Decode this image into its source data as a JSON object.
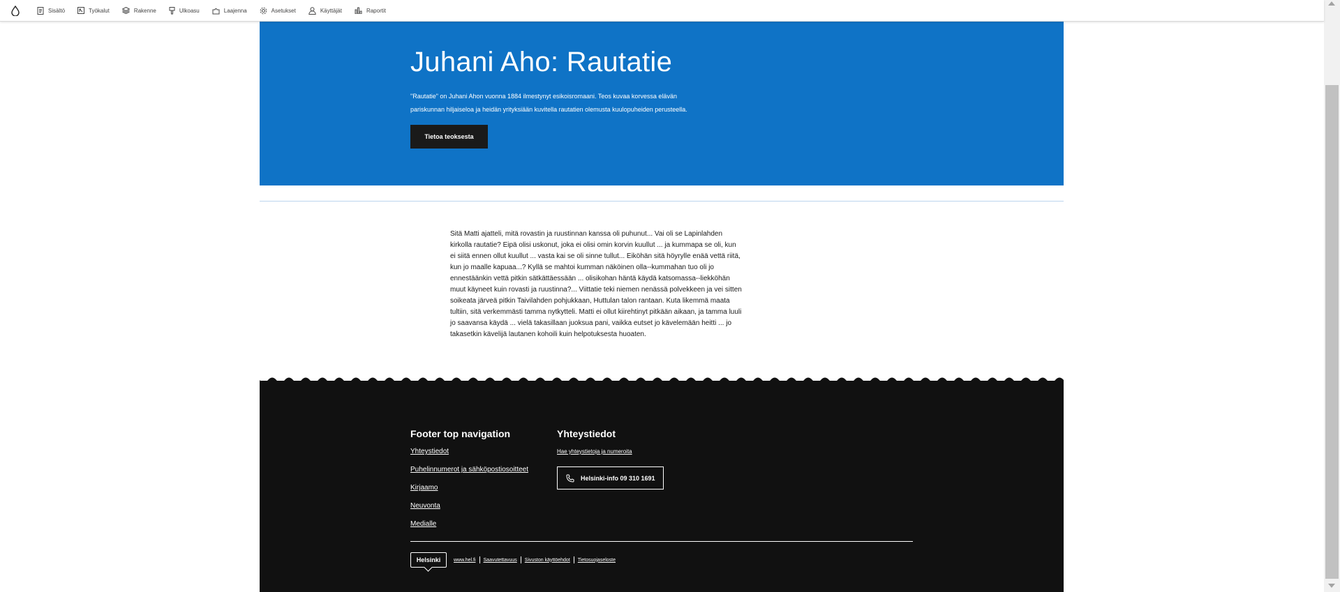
{
  "toolbar": {
    "items": [
      {
        "label": "Sisältö",
        "icon": "document-icon"
      },
      {
        "label": "Työkalut",
        "icon": "tools-icon"
      },
      {
        "label": "Rakenne",
        "icon": "layers-icon"
      },
      {
        "label": "Ulkoasu",
        "icon": "brush-icon"
      },
      {
        "label": "Laajenna",
        "icon": "puzzle-icon"
      },
      {
        "label": "Asetukset",
        "icon": "gear-icon"
      },
      {
        "label": "Käyttäjät",
        "icon": "user-icon"
      },
      {
        "label": "Raportit",
        "icon": "chart-icon"
      }
    ]
  },
  "hero": {
    "title": "Juhani Aho: Rautatie",
    "description": "\"Rautatie\" on Juhani Ahon vuonna 1884 ilmestynyt esikoisromaani. Teos kuvaa korvessa elävän pariskunnan hiljaiseloa ja heidän yrityksiään kuvitella rautatien olemusta kuulopuheiden perusteella.",
    "button_label": "Tietoa teoksesta",
    "background_color": "#0f73c6"
  },
  "article": {
    "text": "Sitä Matti ajatteli, mitä rovastin ja ruustinnan kanssa oli puhunut... Vai oli se Lapinlahden kirkolla rautatie? Eipä olisi uskonut, joka ei olisi omin korvin kuullut ... ja kummapa se oli, kun ei siitä ennen ollut kuullut ... vasta kai se oli sinne tullut... Eiköhän sitä höyrylle enää vettä riitä, kun jo maalle kapuaa...? Kyllä se mahtoi kumman näköinen olla--kummahan tuo oli jo ennestäänkin vettä pitkin sätkättäessään ... olisikohan häntä käydä katsomassa--liekköhän muut käyneet kuin rovasti ja ruustinna?... Viittatie teki niemen nenässä polvekkeen ja vei sitten soikeata järveä pitkin Taivilahden pohjukkaan, Huttulan talon rantaan. Kuta likemmä maata tultiin, sitä verkemmästi tamma nytkytteli. Matti ei ollut kiirehtinyt pitkään aikaan, ja tamma luuli jo saavansa käydä ... vielä takasillaan juoksua pani, vaikka eutset jo kävelemään heitti ... jo takasetkin kävelijä lautanen kohoili kuin helpotuksesta huoaten."
  },
  "footer": {
    "nav_heading": "Footer top navigation",
    "nav_links": [
      "Yhteystiedot",
      "Puhelinnumerot ja sähköpostiosoitteet",
      "Kirjaamo",
      "Neuvonta",
      "Medialle"
    ],
    "contact_heading": "Yhteystiedot",
    "contact_link": "Hae yhteystietoja ja numeroita",
    "phone_label": "Helsinki-info 09 310 1691",
    "logo_text": "Helsinki",
    "bottom_links": [
      "www.hel.fi",
      "Saavutettavuus",
      "Sivuston käyttöehdot",
      "Tietosuojaseloste"
    ],
    "background_color": "#111111"
  }
}
